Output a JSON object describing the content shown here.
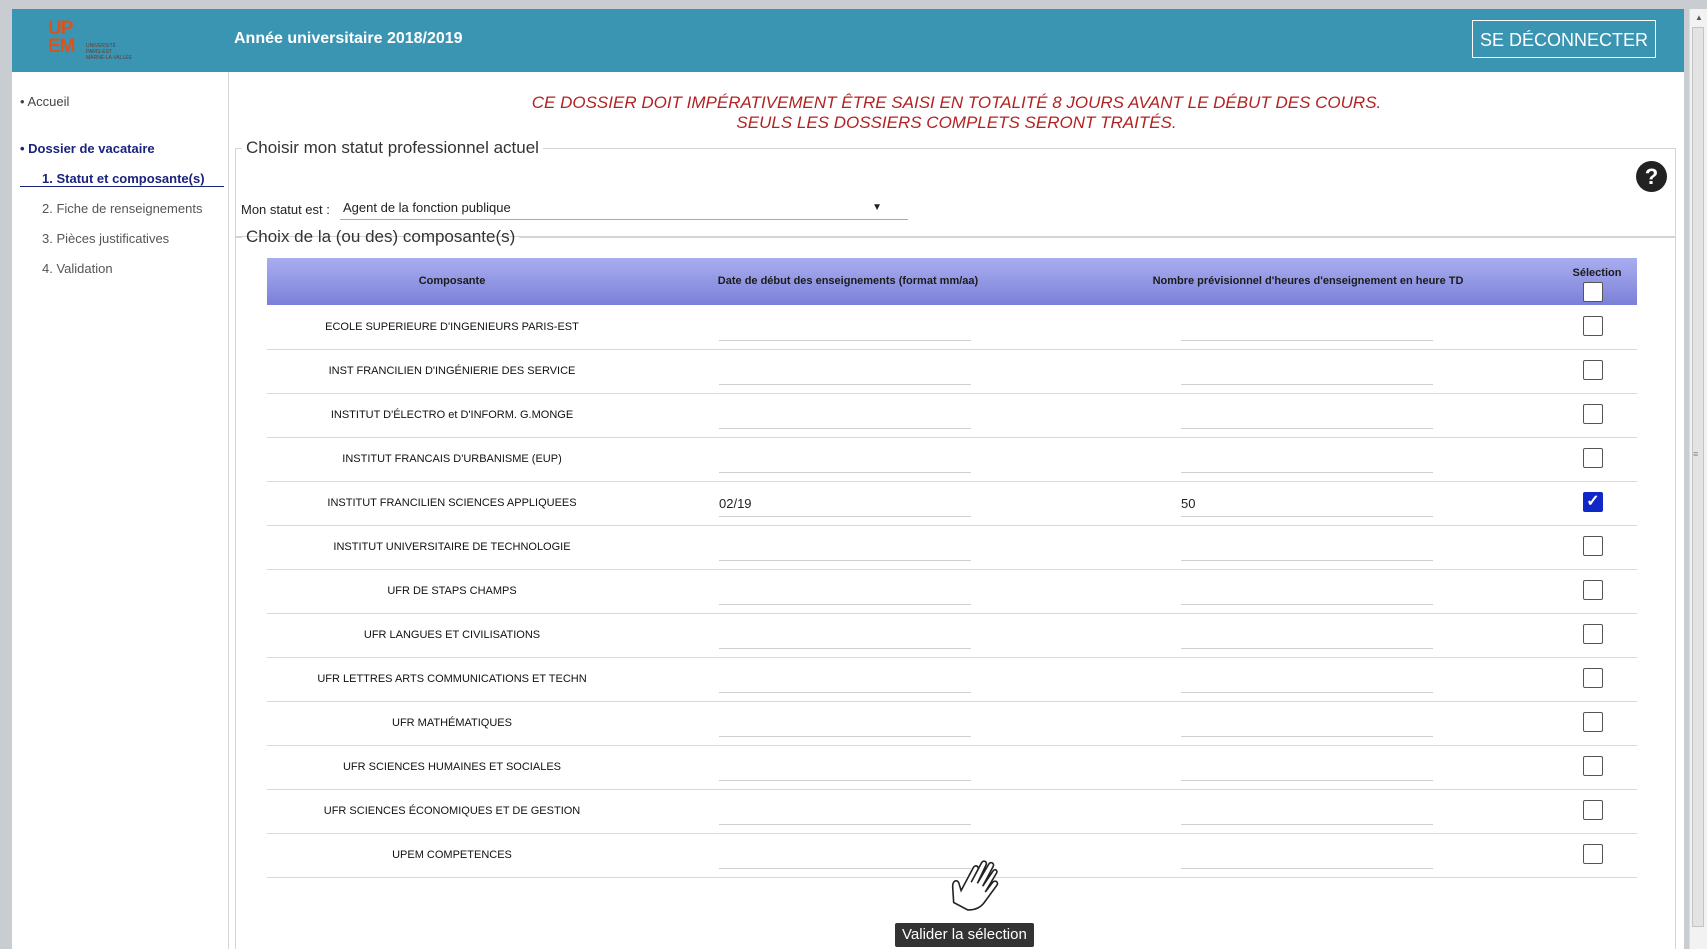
{
  "header": {
    "logo_text": "UP\nEM",
    "logo_subtext": "UNIVERSITÉ\nPARIS-EST\nMARNE-LA-VALLÉE",
    "year": "Année universitaire 2018/2019",
    "logout_label": "SE DÉCONNECTER",
    "background_color": "#3a95b3"
  },
  "sidebar": {
    "home": "Accueil",
    "section": "Dossier de vacataire",
    "steps": [
      {
        "number": "1.",
        "label": "Statut et composante(s)",
        "active": true
      },
      {
        "number": "2.",
        "label": "Fiche de renseignements",
        "active": false
      },
      {
        "number": "3.",
        "label": "Pièces justificatives",
        "active": false
      },
      {
        "number": "4.",
        "label": "Validation",
        "active": false
      }
    ]
  },
  "main": {
    "warning_line1": "CE DOSSIER DOIT IMPÉRATIVEMENT ÊTRE SAISI EN TOTALITÉ 8 JOURS AVANT LE DÉBUT DES COURS.",
    "warning_line2": "SEULS LES DOSSIERS COMPLETS SERONT TRAITÉS.",
    "status_legend": "Choisir mon statut professionnel actuel",
    "status_label": "Mon statut est :",
    "status_value": "Agent de la fonction publique",
    "help_icon_glyph": "?",
    "components_legend": "Choix de la (ou des) composante(s)"
  },
  "table": {
    "headers": {
      "composante": "Composante",
      "date": "Date de début des enseignements (format mm/aa)",
      "heures": "Nombre prévisionnel d'heures d'enseignement en heure TD",
      "selection": "Sélection"
    },
    "rows": [
      {
        "name": "ECOLE SUPERIEURE D'INGENIEURS PARIS-EST",
        "date": "",
        "hours": "",
        "checked": false
      },
      {
        "name": "INST FRANCILIEN D'INGÉNIERIE DES SERVICE",
        "date": "",
        "hours": "",
        "checked": false
      },
      {
        "name": "INSTITUT D'ÉLECTRO et D'INFORM. G.MONGE",
        "date": "",
        "hours": "",
        "checked": false
      },
      {
        "name": "INSTITUT FRANCAIS D'URBANISME (EUP)",
        "date": "",
        "hours": "",
        "checked": false
      },
      {
        "name": "INSTITUT FRANCILIEN SCIENCES APPLIQUEES",
        "date": "02/19",
        "hours": "50",
        "checked": true
      },
      {
        "name": "INSTITUT UNIVERSITAIRE DE TECHNOLOGIE",
        "date": "",
        "hours": "",
        "checked": false
      },
      {
        "name": "UFR DE STAPS CHAMPS",
        "date": "",
        "hours": "",
        "checked": false
      },
      {
        "name": "UFR LANGUES ET CIVILISATIONS",
        "date": "",
        "hours": "",
        "checked": false
      },
      {
        "name": "UFR LETTRES ARTS COMMUNICATIONS ET TECHN",
        "date": "",
        "hours": "",
        "checked": false
      },
      {
        "name": "UFR MATHÉMATIQUES",
        "date": "",
        "hours": "",
        "checked": false
      },
      {
        "name": "UFR SCIENCES HUMAINES ET SOCIALES",
        "date": "",
        "hours": "",
        "checked": false
      },
      {
        "name": "UFR SCIENCES ÉCONOMIQUES ET DE GESTION",
        "date": "",
        "hours": "",
        "checked": false
      },
      {
        "name": "UPEM COMPETENCES",
        "date": "",
        "hours": "",
        "checked": false
      }
    ]
  },
  "tooltip": "Valider la sélection",
  "icons": {
    "hand": "hand-pointer-icon",
    "help": "question-circle-icon",
    "checkmark": "checkmark-icon"
  },
  "colors": {
    "warning": "#b22222",
    "active_step": "#1a237e",
    "table_header": "#8f94e3",
    "checkbox_checked": "#1128c8"
  }
}
